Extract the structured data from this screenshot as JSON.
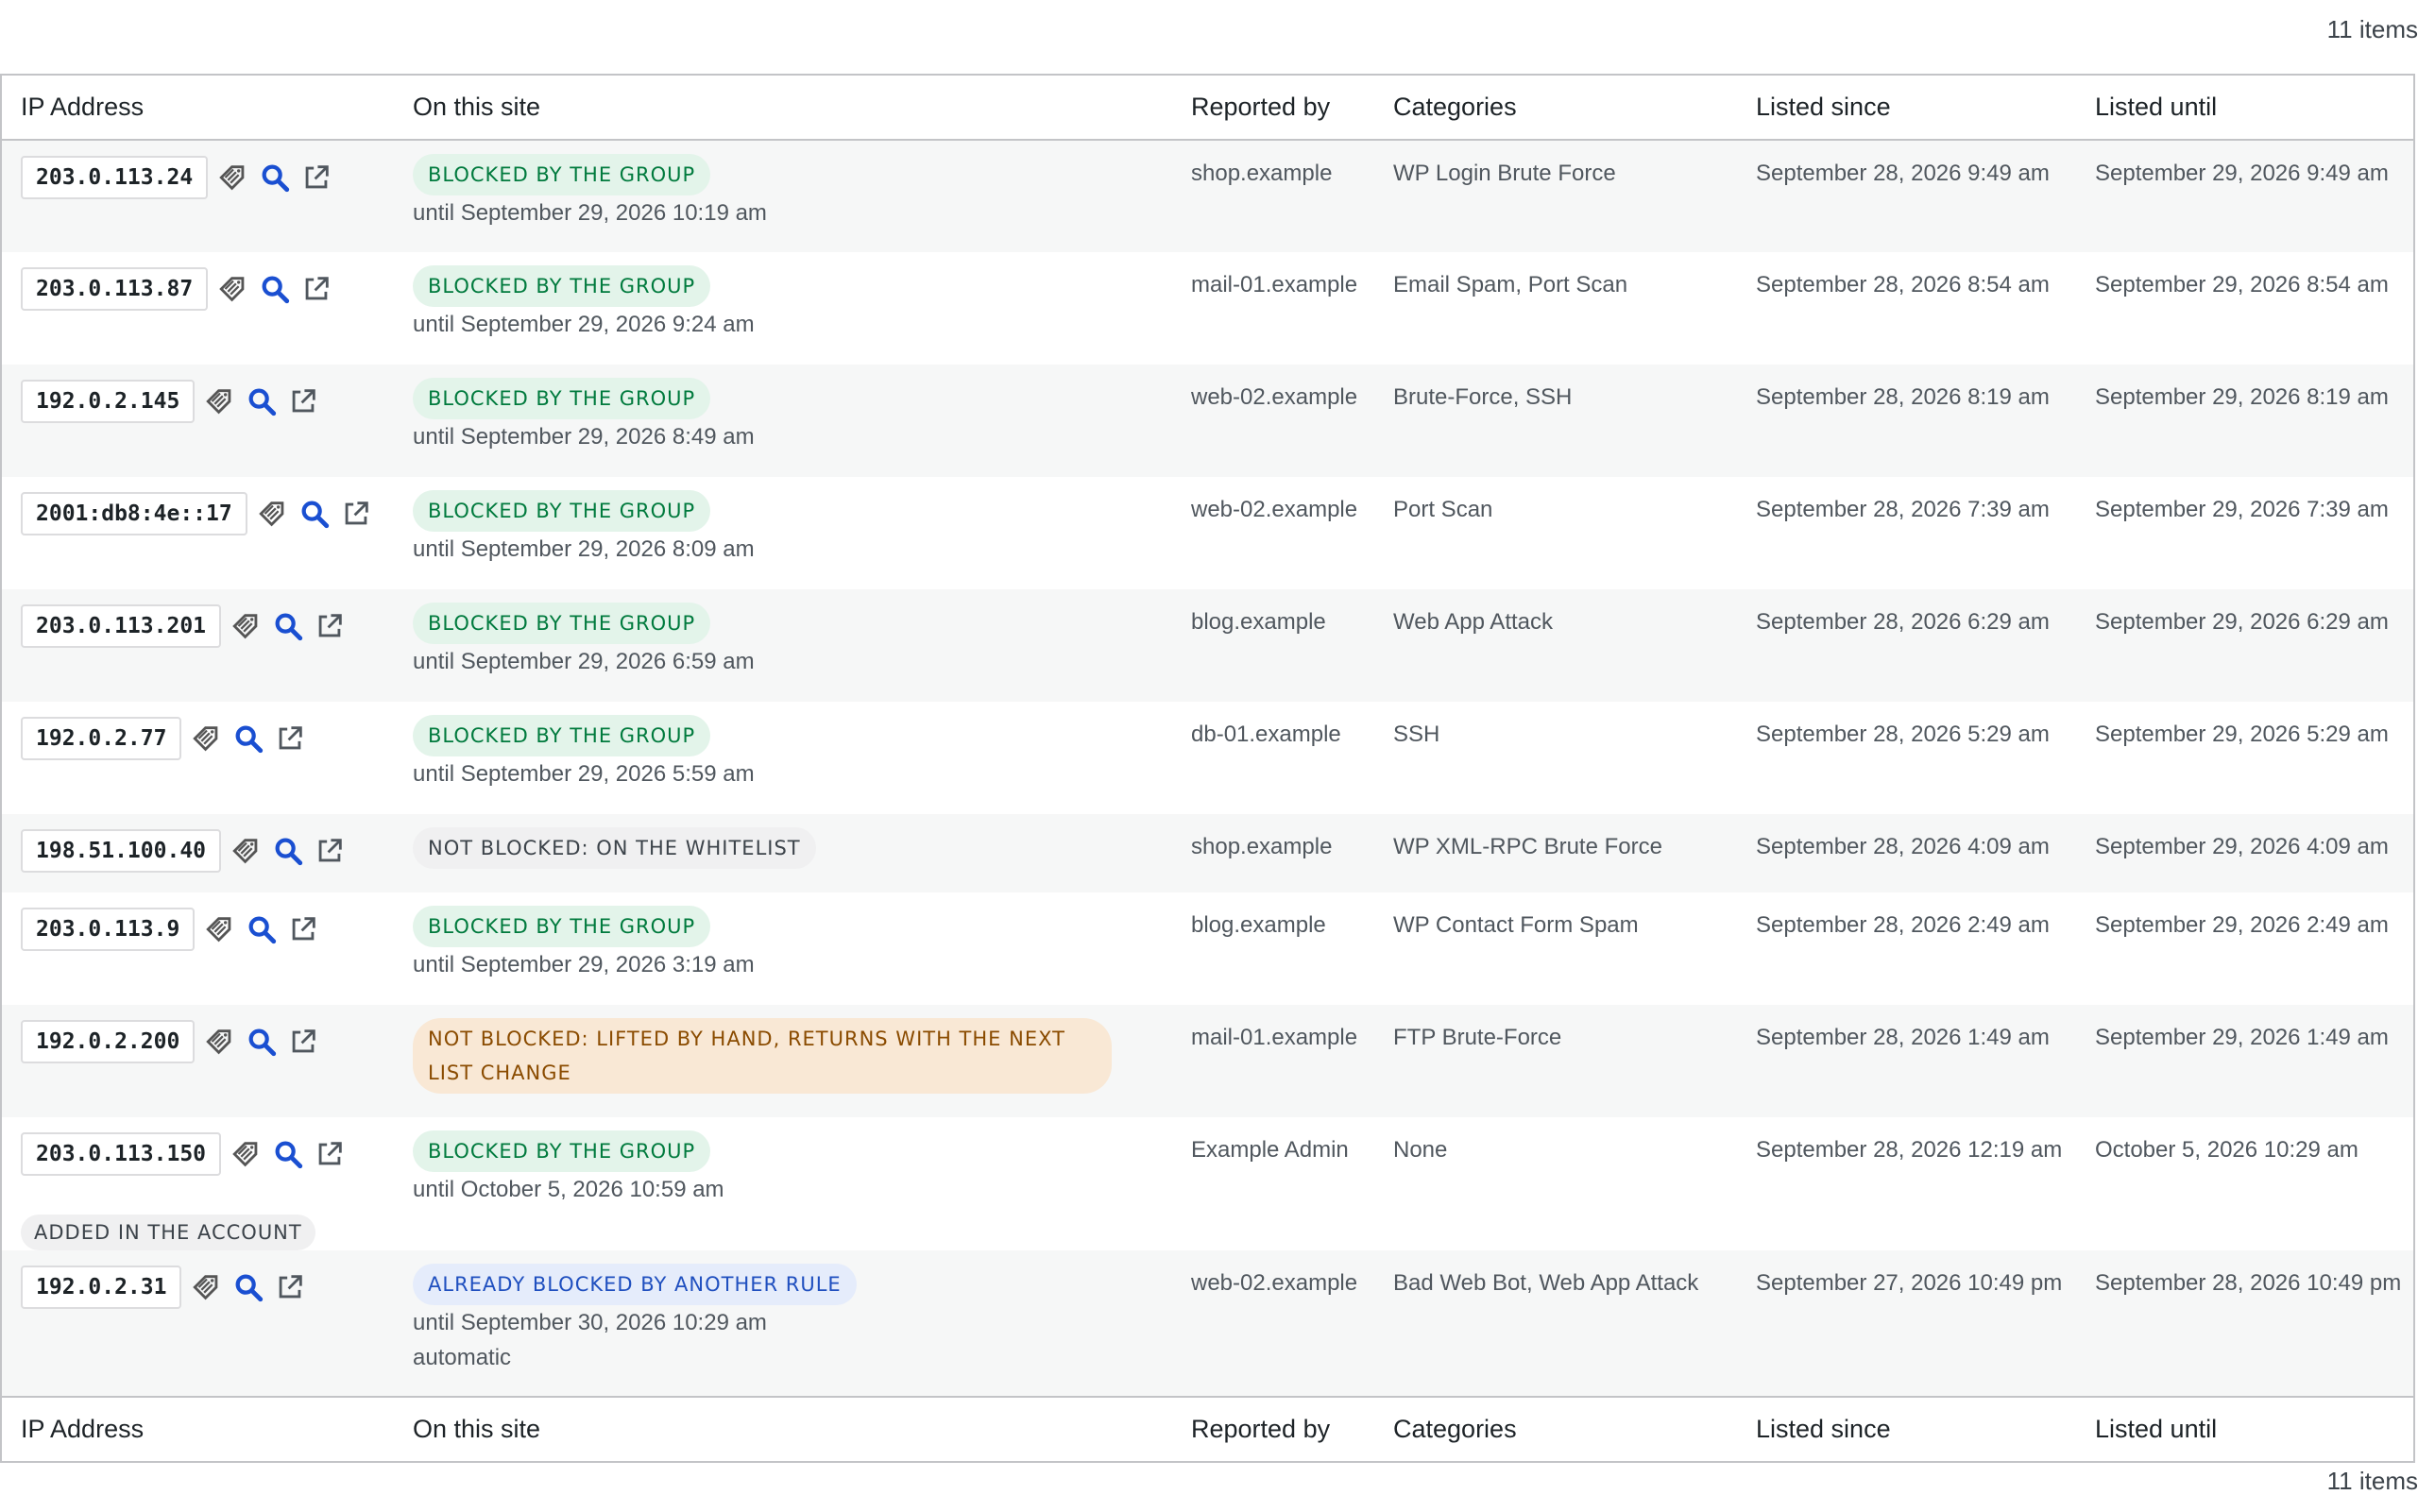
{
  "items_count": "11 items",
  "columns": {
    "ip": "IP Address",
    "site": "On this site",
    "reported_by": "Reported by",
    "categories": "Categories",
    "listed_since": "Listed since",
    "listed_until": "Listed until"
  },
  "icons": [
    "tag-icon",
    "search-icon",
    "external-link-icon"
  ],
  "colors": {
    "green_badge_bg": "#e3f4ea",
    "green_badge_text": "#007a3d",
    "orange_badge_bg": "#f9e8d5",
    "orange_badge_text": "#8a4b00",
    "blue_badge_bg": "#e5ecfb",
    "blue_badge_text": "#1f4fbf",
    "icon_blue": "#2271b1"
  },
  "rows": [
    {
      "ip": "203.0.113.24",
      "status": "BLOCKED BY THE GROUP",
      "status_kind": "green",
      "until": "until September 29, 2026 10:19 am",
      "note": "",
      "account": "",
      "reported_by": "shop.example",
      "categories": "WP Login Brute Force",
      "since": "September 28, 2026 9:49 am",
      "listed_until": "September 29, 2026 9:49 am"
    },
    {
      "ip": "203.0.113.87",
      "status": "BLOCKED BY THE GROUP",
      "status_kind": "green",
      "until": "until September 29, 2026 9:24 am",
      "note": "",
      "account": "",
      "reported_by": "mail-01.example",
      "categories": "Email Spam, Port Scan",
      "since": "September 28, 2026 8:54 am",
      "listed_until": "September 29, 2026 8:54 am"
    },
    {
      "ip": "192.0.2.145",
      "status": "BLOCKED BY THE GROUP",
      "status_kind": "green",
      "until": "until September 29, 2026 8:49 am",
      "note": "",
      "account": "",
      "reported_by": "web-02.example",
      "categories": "Brute-Force, SSH",
      "since": "September 28, 2026 8:19 am",
      "listed_until": "September 29, 2026 8:19 am"
    },
    {
      "ip": "2001:db8:4e::17",
      "status": "BLOCKED BY THE GROUP",
      "status_kind": "green",
      "until": "until September 29, 2026 8:09 am",
      "note": "",
      "account": "",
      "reported_by": "web-02.example",
      "categories": "Port Scan",
      "since": "September 28, 2026 7:39 am",
      "listed_until": "September 29, 2026 7:39 am"
    },
    {
      "ip": "203.0.113.201",
      "status": "BLOCKED BY THE GROUP",
      "status_kind": "green",
      "until": "until September 29, 2026 6:59 am",
      "note": "",
      "account": "",
      "reported_by": "blog.example",
      "categories": "Web App Attack",
      "since": "September 28, 2026 6:29 am",
      "listed_until": "September 29, 2026 6:29 am"
    },
    {
      "ip": "192.0.2.77",
      "status": "BLOCKED BY THE GROUP",
      "status_kind": "green",
      "until": "until September 29, 2026 5:59 am",
      "note": "",
      "account": "",
      "reported_by": "db-01.example",
      "categories": "SSH",
      "since": "September 28, 2026 5:29 am",
      "listed_until": "September 29, 2026 5:29 am"
    },
    {
      "ip": "198.51.100.40",
      "status": "NOT BLOCKED: ON THE WHITELIST",
      "status_kind": "grey",
      "until": "",
      "note": "",
      "account": "",
      "reported_by": "shop.example",
      "categories": "WP XML-RPC Brute Force",
      "since": "September 28, 2026 4:09 am",
      "listed_until": "September 29, 2026 4:09 am"
    },
    {
      "ip": "203.0.113.9",
      "status": "BLOCKED BY THE GROUP",
      "status_kind": "green",
      "until": "until September 29, 2026 3:19 am",
      "note": "",
      "account": "",
      "reported_by": "blog.example",
      "categories": "WP Contact Form Spam",
      "since": "September 28, 2026 2:49 am",
      "listed_until": "September 29, 2026 2:49 am"
    },
    {
      "ip": "192.0.2.200",
      "status": "NOT BLOCKED: LIFTED BY HAND, RETURNS WITH THE NEXT LIST CHANGE",
      "status_kind": "orange",
      "until": "",
      "note": "",
      "account": "",
      "reported_by": "mail-01.example",
      "categories": "FTP Brute-Force",
      "since": "September 28, 2026 1:49 am",
      "listed_until": "September 29, 2026 1:49 am"
    },
    {
      "ip": "203.0.113.150",
      "status": "BLOCKED BY THE GROUP",
      "status_kind": "green",
      "until": "until October 5, 2026 10:59 am",
      "note": "",
      "account": "ADDED IN THE ACCOUNT",
      "reported_by": "Example Admin",
      "categories": "None",
      "since": "September 28, 2026 12:19 am",
      "listed_until": "October 5, 2026 10:29 am"
    },
    {
      "ip": "192.0.2.31",
      "status": "ALREADY BLOCKED BY ANOTHER RULE",
      "status_kind": "blue",
      "until": "until September 30, 2026 10:29 am",
      "note": "automatic",
      "account": "",
      "reported_by": "web-02.example",
      "categories": "Bad Web Bot, Web App Attack",
      "since": "September 27, 2026 10:49 pm",
      "listed_until": "September 28, 2026 10:49 pm"
    }
  ]
}
